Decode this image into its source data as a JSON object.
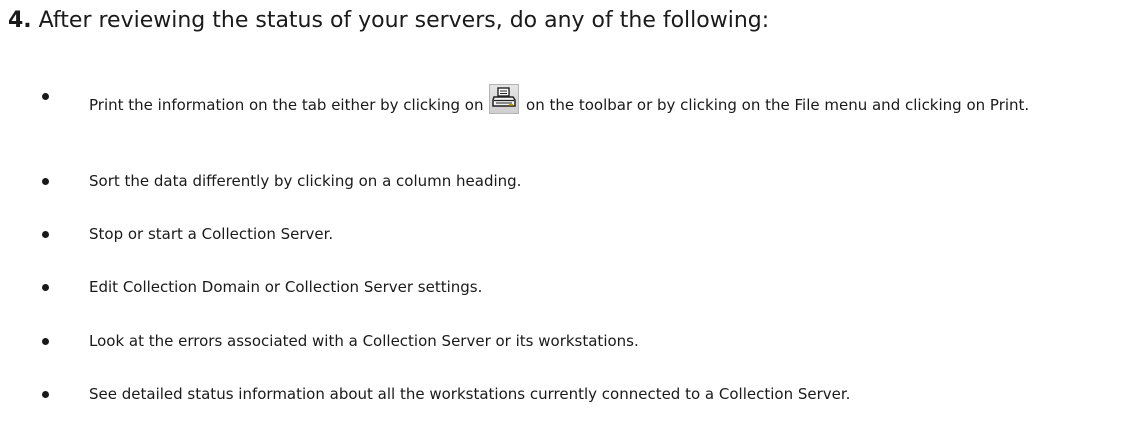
{
  "step": {
    "number": "4.",
    "text": " After reviewing the status of your servers, do any of the following:"
  },
  "items": [
    {
      "before_icon": "Print the information on the tab either by clicking on ",
      "icon": "printer-icon",
      "after_icon": " on the toolbar or by clicking on the File menu and clicking on Print."
    },
    {
      "text": "Sort the data differently by clicking on a column heading."
    },
    {
      "text": "Stop or start a Collection Server."
    },
    {
      "text": "Edit Collection Domain or Collection Server settings."
    },
    {
      "text": "Look at the errors associated with a Collection Server or its workstations."
    },
    {
      "text": "See detailed status information about all the workstations currently connected to a Collection Server."
    }
  ]
}
